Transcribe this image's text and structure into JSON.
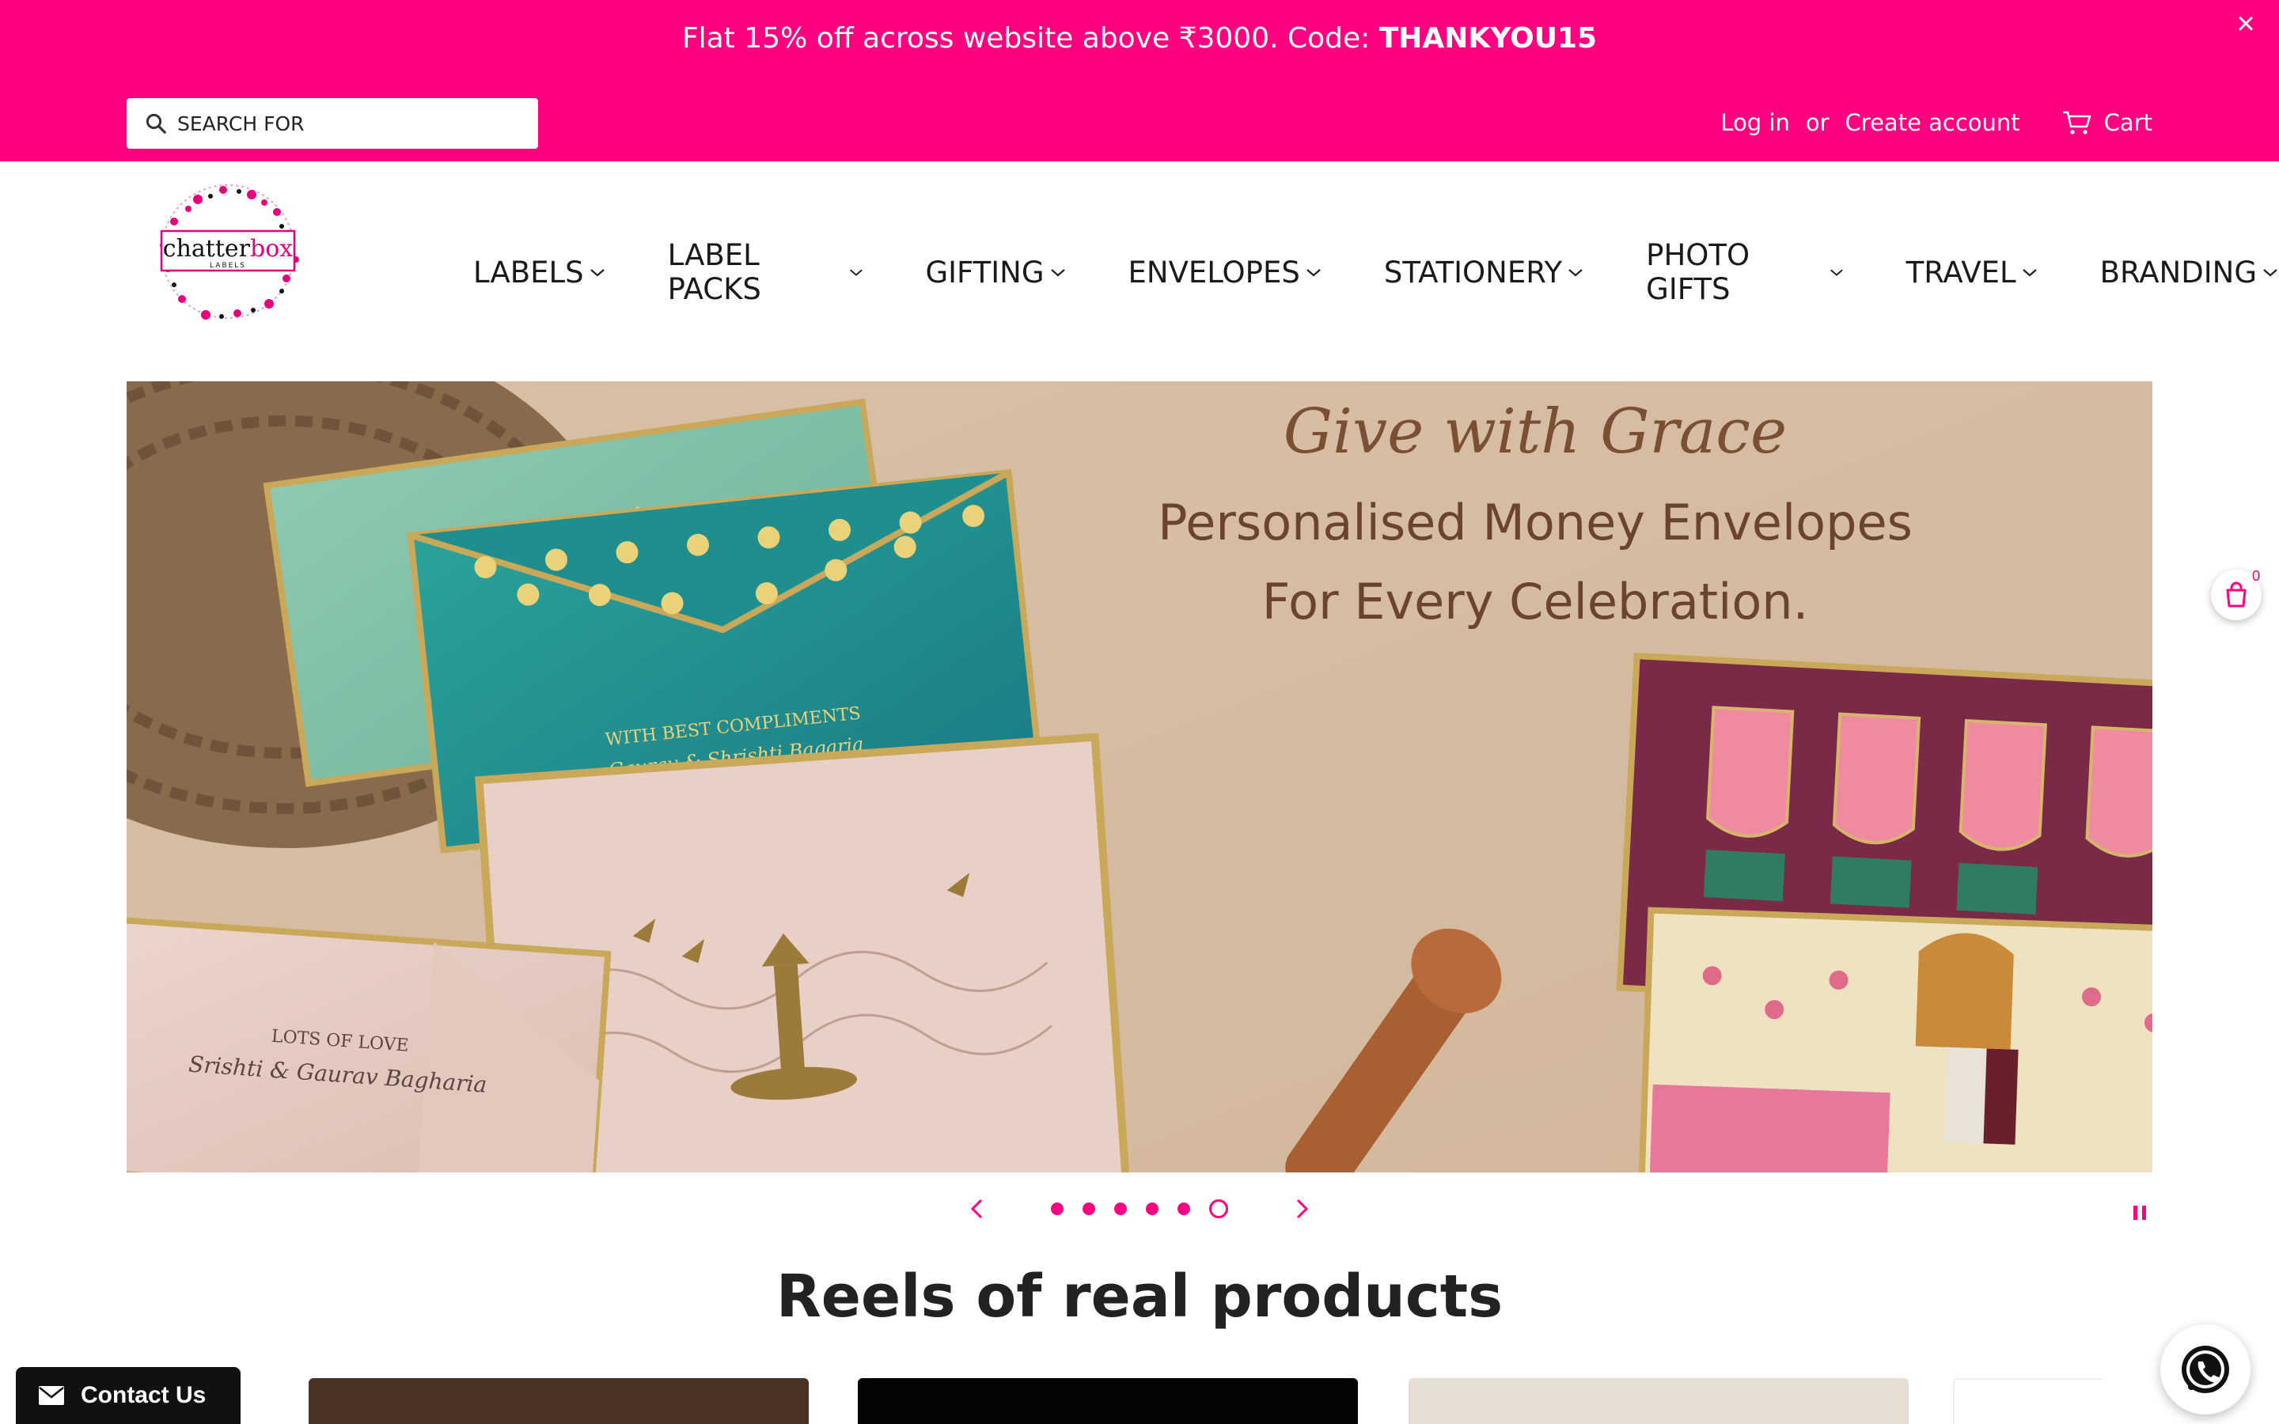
{
  "announcement": {
    "text": "Flat 15% off across website above ₹3000. Code: ",
    "code": "THANKYOU15",
    "close_icon": "close-icon"
  },
  "search": {
    "placeholder": "SEARCH FOR",
    "icon": "search-icon"
  },
  "account": {
    "login": "Log in",
    "or": "or",
    "create": "Create account",
    "cart": "Cart"
  },
  "logo": {
    "line1": "chatter",
    "line2": "box",
    "line3": "LABELS"
  },
  "nav": {
    "items": [
      {
        "label": "LABELS"
      },
      {
        "label": "LABEL PACKS"
      },
      {
        "label": "GIFTING"
      },
      {
        "label": "ENVELOPES"
      },
      {
        "label": "STATIONERY"
      },
      {
        "label": "PHOTO GIFTS"
      },
      {
        "label": "TRAVEL"
      },
      {
        "label": "BRANDING"
      }
    ]
  },
  "hero": {
    "heading": "Give with Grace",
    "line1": "Personalised  Money  Envelopes",
    "line2": "For  Every  Celebration.",
    "envelope1_text1": "WITH BEST COMPLIMENTS",
    "envelope1_text2": "Gaurav & Shrishti Bagaria",
    "envelope2_text1": "LOTS OF LOVE",
    "envelope2_text2": "Srishti & Gaurav Bagharia",
    "slide_count": 6,
    "active_slide": 6
  },
  "section": {
    "title": "Reels of real products"
  },
  "contact": {
    "label": "Contact Us"
  },
  "floating_cart": {
    "count": "0"
  },
  "colors": {
    "brand_pink": "#ff0080",
    "hero_bg": "#d9c2aa",
    "text_dark": "#222222"
  }
}
